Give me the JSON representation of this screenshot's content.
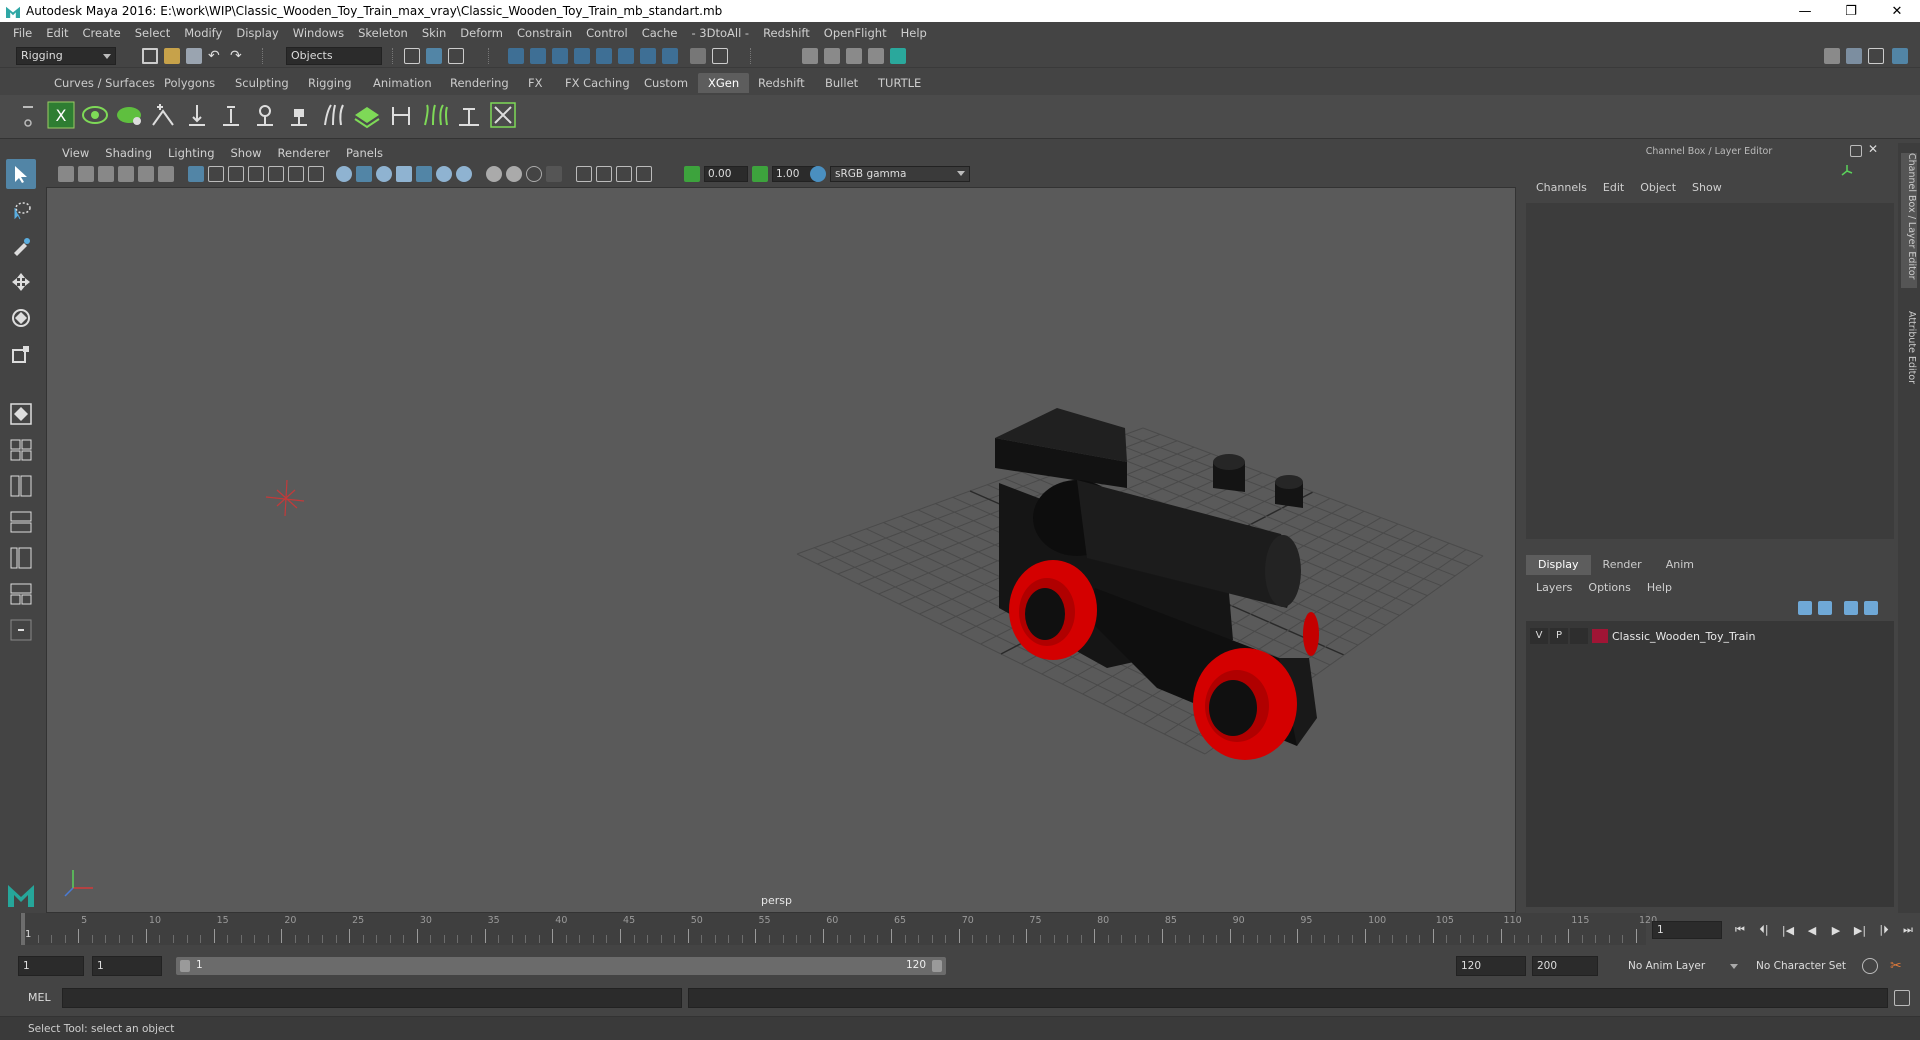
{
  "window": {
    "title": "Autodesk Maya 2016: E:\\work\\WIP\\Classic_Wooden_Toy_Train_max_vray\\Classic_Wooden_Toy_Train_mb_standart.mb",
    "minimize": "—",
    "restore": "❐",
    "close": "✕"
  },
  "menubar": [
    "File",
    "Edit",
    "Create",
    "Select",
    "Modify",
    "Display",
    "Windows",
    "Skeleton",
    "Skin",
    "Deform",
    "Constrain",
    "Control",
    "Cache",
    "- 3DtoAll -",
    "Redshift",
    "OpenFlight",
    "Help"
  ],
  "status_line": {
    "mode": "Rigging",
    "selection_field": "Objects"
  },
  "shelf": {
    "tabs": [
      "Curves / Surfaces",
      "Polygons",
      "Sculpting",
      "Rigging",
      "Animation",
      "Rendering",
      "FX",
      "FX Caching",
      "Custom",
      "XGen",
      "Redshift",
      "Bullet",
      "TURTLE"
    ],
    "active_tab": "XGen"
  },
  "viewport": {
    "menu": [
      "View",
      "Shading",
      "Lighting",
      "Show",
      "Renderer",
      "Panels"
    ],
    "exposure": "0.00",
    "gamma": "1.00",
    "color_space": "sRGB gamma",
    "camera_label": "persp"
  },
  "channel_box": {
    "title": "Channel Box / Layer Editor",
    "menu": [
      "Channels",
      "Edit",
      "Object",
      "Show"
    ]
  },
  "layer_editor": {
    "tabs": [
      "Display",
      "Render",
      "Anim"
    ],
    "active_tab": "Display",
    "menu": [
      "Layers",
      "Options",
      "Help"
    ],
    "layers": [
      {
        "visible": "V",
        "playback": "P",
        "name": "Classic_Wooden_Toy_Train",
        "color": "#a01535"
      }
    ]
  },
  "side_tabs": [
    "Channel Box / Layer Editor",
    "Attribute Editor"
  ],
  "timeline": {
    "labels": [
      "5",
      "10",
      "15",
      "20",
      "25",
      "30",
      "35",
      "40",
      "45",
      "50",
      "55",
      "60",
      "65",
      "70",
      "75",
      "80",
      "85",
      "90",
      "95",
      "100",
      "105",
      "110",
      "115",
      "120"
    ],
    "current_frame_marker": "1",
    "current_frame_field": "1",
    "playback_buttons": [
      "⏮",
      "⏴|",
      "|◀",
      "◀",
      "▶",
      "▶|",
      "|⏵",
      "⏭"
    ]
  },
  "range_slider": {
    "start_frame": "1",
    "playback_start": "1",
    "range_inner_start": "1",
    "range_inner_end": "120",
    "playback_end": "120",
    "end_frame": "200",
    "anim_layer": "No Anim Layer",
    "character_set": "No Character Set"
  },
  "command_line": {
    "label": "MEL"
  },
  "help_line": {
    "text": "Select Tool: select an object"
  },
  "colors": {
    "accent_active_tool": "#5285a6",
    "train_body": "#1a1a1a",
    "train_wheels": "#d40000",
    "viewport_bg": "#5a5a5a"
  }
}
